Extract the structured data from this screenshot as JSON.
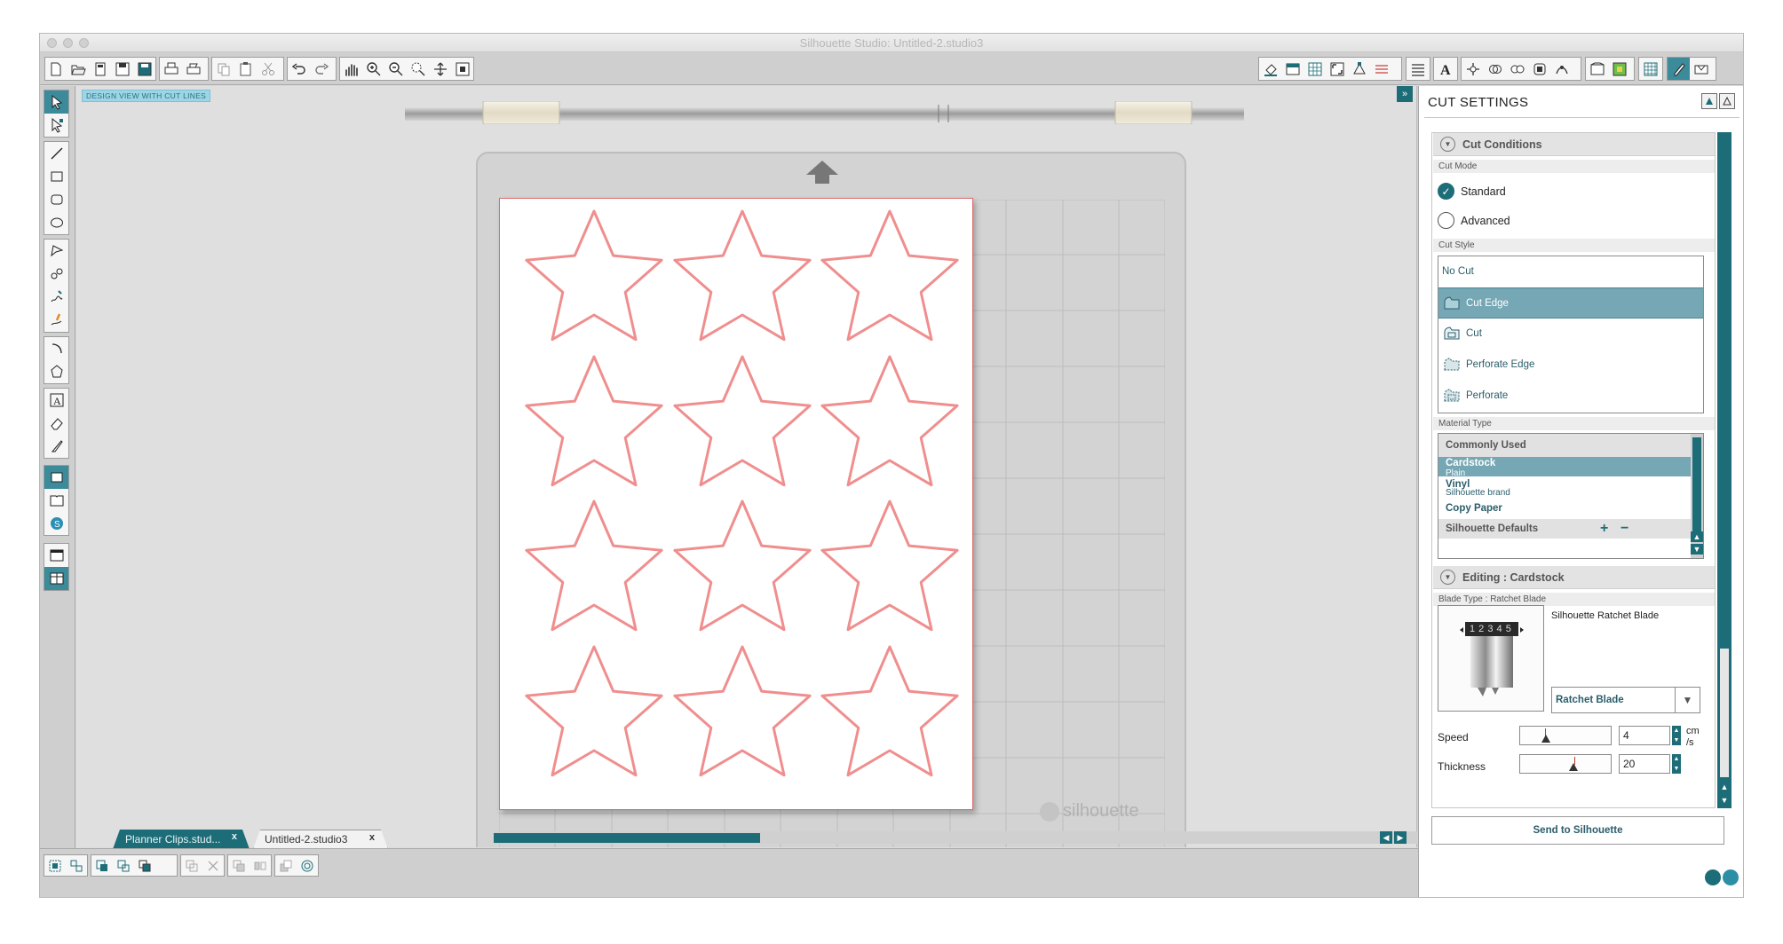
{
  "window": {
    "title": "Silhouette Studio: Untitled-2.studio3"
  },
  "canvas": {
    "view_badge": "DESIGN VIEW WITH CUT LINES",
    "mat_logo": "silhouette"
  },
  "shapes": {
    "rows": 4,
    "cols": 3,
    "kind": "star",
    "stroke_color": "#f08e8e"
  },
  "tabs": [
    {
      "label": "Planner Clips.stud...",
      "close": "x"
    },
    {
      "label": "Untitled-2.studio3",
      "close": "x"
    }
  ],
  "toolbar": {
    "left_icons": [
      "new-file-icon",
      "open-icon",
      "sd-icon",
      "save-icon",
      "save-library-icon",
      "print-icon",
      "print-cut-icon",
      "copy-icon",
      "paste-icon",
      "cut-icon",
      "undo-icon",
      "redo-icon",
      "pan-icon",
      "zoom-in-icon",
      "zoom-out-icon",
      "zoom-select-icon",
      "drag-zoom-icon",
      "fit-page-icon"
    ],
    "right_icons": [
      "fill-color-icon",
      "page-setup-icon",
      "grid-icon",
      "registration-icon",
      "nodes-icon",
      "line-style-icon",
      "line-fill-icon",
      "text-style-icon",
      "transform-icon",
      "replicate-icon",
      "modify-icon",
      "offset-icon",
      "trace-icon",
      "library-icon",
      "store-icon",
      "pixscan-icon",
      "sketch-icon",
      "cut-settings-icon",
      "send-icon"
    ]
  },
  "panel": {
    "title": "CUT SETTINGS",
    "cut_conditions": {
      "header": "Cut Conditions",
      "cut_mode_label": "Cut Mode",
      "modes": [
        {
          "label": "Standard",
          "selected": true
        },
        {
          "label": "Advanced",
          "selected": false
        }
      ],
      "cut_style_label": "Cut Style",
      "styles": [
        {
          "label": "No Cut",
          "selected": false
        },
        {
          "label": "Cut Edge",
          "selected": true
        },
        {
          "label": "Cut",
          "selected": false
        },
        {
          "label": "Perforate Edge",
          "selected": false
        },
        {
          "label": "Perforate",
          "selected": false
        }
      ],
      "material_type_label": "Material Type",
      "material_header": "Commonly Used",
      "materials": [
        {
          "name": "Cardstock",
          "sub": "Plain",
          "selected": true
        },
        {
          "name": "Vinyl",
          "sub": "Silhouette brand",
          "selected": false
        },
        {
          "name": "Copy Paper",
          "sub": "",
          "selected": false
        }
      ],
      "material_footer": "Silhouette Defaults",
      "add": "+",
      "remove": "−"
    },
    "editing": {
      "header": "Editing : Cardstock",
      "blade_type_label": "Blade Type : Ratchet Blade",
      "blade_name": "Silhouette Ratchet Blade",
      "blade_digits": "1 2 3 4 5",
      "blade_select": "Ratchet Blade",
      "speed": {
        "label": "Speed",
        "value": "4",
        "unit": "cm\n/s",
        "fraction": 0.28
      },
      "thickness": {
        "label": "Thickness",
        "value": "20",
        "fraction": 0.59
      }
    },
    "send_button": "Send to Silhouette"
  },
  "colors": {
    "teal": "#1d6d78",
    "teal_light": "#76a7b4",
    "star": "#f08e8e",
    "paper_border": "#d96a6a"
  }
}
